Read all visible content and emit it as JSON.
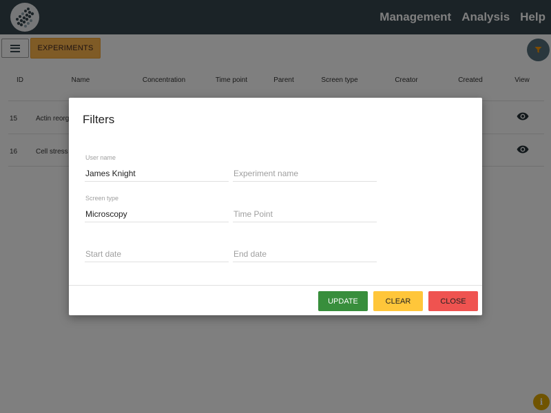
{
  "nav": {
    "management": "Management",
    "analysis": "Analysis",
    "help": "Help"
  },
  "toolbar": {
    "experiments_label": "EXPERIMENTS"
  },
  "table": {
    "columns": [
      "ID",
      "Name",
      "Concentration",
      "Time point",
      "Parent",
      "Screen type",
      "Creator",
      "Created",
      "View"
    ],
    "rows": [
      {
        "id": "15",
        "name": "Actin reorg"
      },
      {
        "id": "16",
        "name": "Cell stress"
      }
    ]
  },
  "filters": {
    "title": "Filters",
    "user_name": {
      "label": "User name",
      "value": "James Knight"
    },
    "experiment_name": {
      "placeholder": "Experiment name"
    },
    "screen_type": {
      "label": "Screen type",
      "value": "Microscopy"
    },
    "time_point": {
      "placeholder": "Time Point"
    },
    "start_date": {
      "placeholder": "Start date"
    },
    "end_date": {
      "placeholder": "End date"
    },
    "buttons": {
      "update": "UPDATE",
      "clear": "CLEAR",
      "close": "CLOSE"
    }
  },
  "colors": {
    "header": "#37474f",
    "experiments_button": "#ffb74d",
    "update": "#388e3c",
    "clear": "#ffc63a",
    "close": "#ef5350",
    "filter_fab": "#546e7a",
    "info_fab": "#e0a800"
  },
  "icons": [
    "app-logo-icon",
    "list-icon",
    "filter-icon",
    "eye-icon",
    "info-icon"
  ]
}
